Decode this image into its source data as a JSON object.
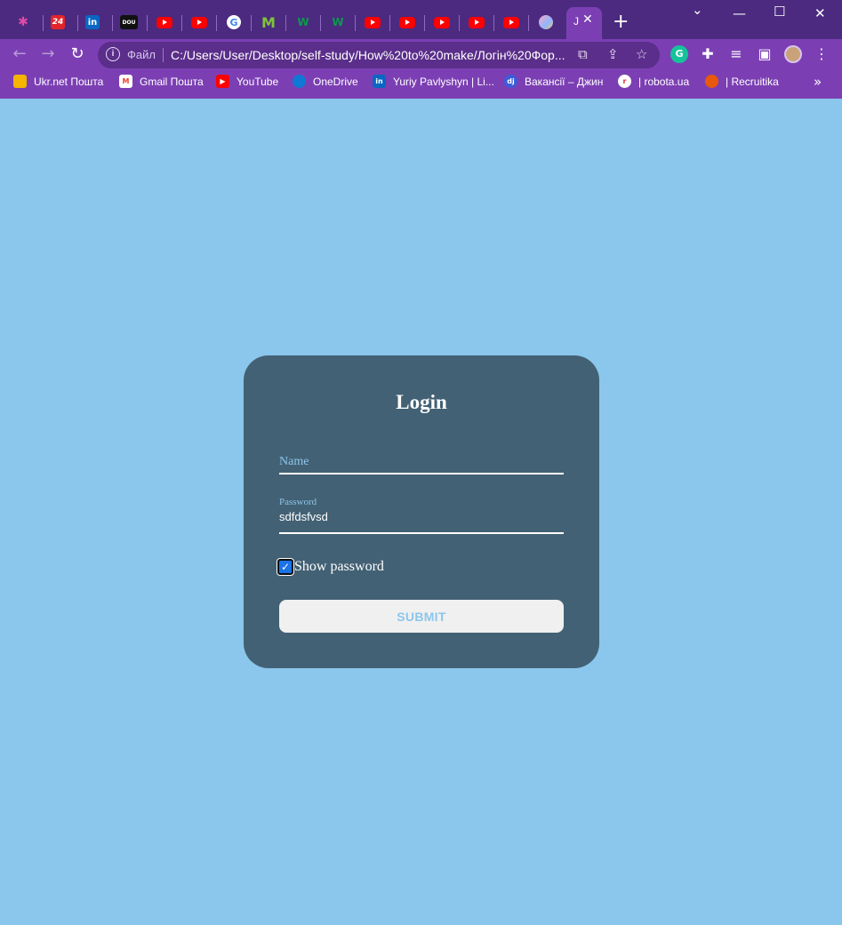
{
  "browser": {
    "tabs": [
      {
        "icon": "flower-icon",
        "text": "✱"
      },
      {
        "icon": "news24-icon",
        "text": "24"
      },
      {
        "icon": "linkedin-icon",
        "text": "in"
      },
      {
        "icon": "dou-icon",
        "text": "DOU"
      },
      {
        "icon": "youtube-icon",
        "text": ""
      },
      {
        "icon": "youtube-icon",
        "text": ""
      },
      {
        "icon": "google-icon",
        "text": "G"
      },
      {
        "icon": "m-icon",
        "text": "M"
      },
      {
        "icon": "w-icon",
        "text": "W"
      },
      {
        "icon": "w-icon",
        "text": "W"
      },
      {
        "icon": "youtube-icon",
        "text": ""
      },
      {
        "icon": "youtube-icon",
        "text": ""
      },
      {
        "icon": "youtube-icon",
        "text": ""
      },
      {
        "icon": "youtube-icon",
        "text": ""
      },
      {
        "icon": "gradient-circle-icon",
        "text": ""
      }
    ],
    "active_tab": {
      "letter": "J",
      "close": "✕"
    },
    "new_tab": "+",
    "window": {
      "minimize": "—",
      "maximize": "☐",
      "close": "✕",
      "dropdown": "⌄"
    },
    "omnibox": {
      "info": "i",
      "scheme_label": "Файл",
      "url": "C:/Users/User/Desktop/self-study/How%20to%20make/Логін%20Фор..."
    },
    "bookmarks": [
      {
        "label": "Ukr.net Пошта",
        "icon": "ukrnet-icon",
        "color": "#f4b400"
      },
      {
        "label": "Gmail Пошта",
        "icon": "gmail-icon",
        "color": "#ea4335"
      },
      {
        "label": "YouTube",
        "icon": "youtube-icon",
        "color": "#ff0000"
      },
      {
        "label": "OneDrive",
        "icon": "onedrive-icon",
        "color": "#0f78d4"
      },
      {
        "label": "Yuriy Pavlyshyn | Li...",
        "icon": "linkedin-icon",
        "color": "#0a66c2"
      },
      {
        "label": "Вакансії – Джин",
        "icon": "djinni-icon",
        "color": "#3b5bdb"
      },
      {
        "label": "| robota.ua",
        "icon": "robota-icon",
        "color": "#e03131"
      },
      {
        "label": "| Recruitika",
        "icon": "recruitika-icon",
        "color": "#e8590c"
      }
    ],
    "bookmarks_more": "»"
  },
  "login": {
    "title": "Login",
    "name_placeholder": "Name",
    "password_label": "Password",
    "password_value": "sdfdsfvsd",
    "show_password_label": "Show password",
    "show_password_checked": true,
    "submit_label": "SUBMIT"
  },
  "colors": {
    "page_bg": "#8bc6ec",
    "card_bg": "#436174",
    "browser_frame": "#7b3fb3"
  }
}
